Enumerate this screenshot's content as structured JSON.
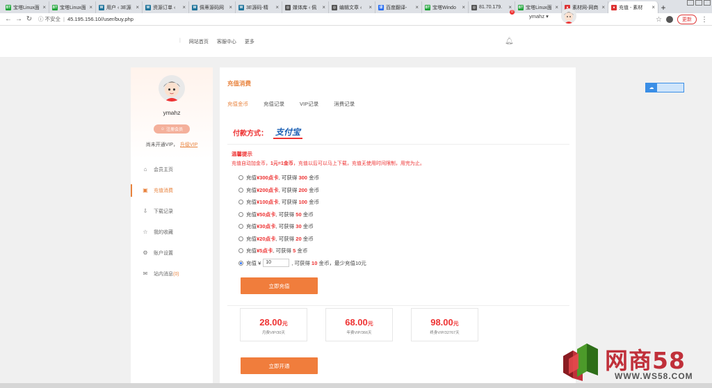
{
  "browser": {
    "tabs": [
      {
        "label": "宝塔Linux面",
        "fav": "BT",
        "color": "#20a53a"
      },
      {
        "label": "宝塔Linux面",
        "fav": "BT",
        "color": "#20a53a"
      },
      {
        "label": "用户 ‹ 3E源",
        "fav": "W",
        "color": "#21759b"
      },
      {
        "label": "资源订单 ‹",
        "fav": "W",
        "color": "#21759b"
      },
      {
        "label": "佩蒂源码网",
        "fav": "W",
        "color": "#21759b"
      },
      {
        "label": "3E源码-精",
        "fav": "W",
        "color": "#21759b"
      },
      {
        "label": "媒体库 ‹ 佩",
        "fav": "◎",
        "color": "#555"
      },
      {
        "label": "编辑文章 ‹",
        "fav": "◎",
        "color": "#555"
      },
      {
        "label": "百度翻译-",
        "fav": "译",
        "color": "#2a6ef0"
      },
      {
        "label": "宝塔Windo",
        "fav": "BT",
        "color": "#20a53a"
      },
      {
        "label": "81.70.179.",
        "fav": "◎",
        "color": "#555"
      },
      {
        "label": "宝塔Linux面",
        "fav": "BT",
        "color": "#20a53a"
      },
      {
        "label": "素材网-网商",
        "fav": "●",
        "color": "#d33"
      },
      {
        "label": "充值 - 素材",
        "fav": "●",
        "color": "#d33",
        "active": true
      }
    ],
    "insecure_label": "不安全",
    "url": "45.195.156.10//user/buy.php",
    "update_label": "更新"
  },
  "header": {
    "nav": [
      "网站首页",
      "客服中心",
      "更多"
    ],
    "notif_count": "0",
    "username": "ymahz ▾"
  },
  "sidebar": {
    "username": "ymahz",
    "badge": "注册会员",
    "vip_status": "尚未开通VIP，",
    "upgrade": "升级VIP",
    "items": [
      {
        "label": "会员主页",
        "icon": "⌂",
        "name": "home-icon"
      },
      {
        "label": "充值消费",
        "icon": "▣",
        "name": "wallet-icon",
        "active": true
      },
      {
        "label": "下载记录",
        "icon": "⇩",
        "name": "download-icon"
      },
      {
        "label": "我的收藏",
        "icon": "☆",
        "name": "star-icon"
      },
      {
        "label": "账户设置",
        "icon": "⚙",
        "name": "gear-icon"
      },
      {
        "label": "站内消息",
        "icon": "✉",
        "name": "mail-icon",
        "count": "(0)"
      }
    ]
  },
  "main": {
    "title": "充值消费",
    "tabs": [
      "充值金币",
      "充值记录",
      "VIP记录",
      "消费记录"
    ],
    "pay_label": "付款方式：",
    "pay_method": "支付宝",
    "notice_title": "温馨提示",
    "notice_pre": "充值自动加金币，",
    "notice_strong": "1元=1金币",
    "notice_post": "，充值以后可以马上下载，充值无使用时间限制，用完为止。",
    "options": [
      {
        "card": "¥300点卡",
        "coins": "300"
      },
      {
        "card": "¥200点卡",
        "coins": "200"
      },
      {
        "card": "¥100点卡",
        "coins": "100"
      },
      {
        "card": "¥50点卡",
        "coins": "50"
      },
      {
        "card": "¥30点卡",
        "coins": "30"
      },
      {
        "card": "¥20点卡",
        "coins": "20"
      },
      {
        "card": "¥5点卡",
        "coins": "5"
      }
    ],
    "opt_prefix": "充值",
    "opt_mid": ", 可获得",
    "opt_suffix": "金币",
    "custom": {
      "prefix": "充值 ¥",
      "value": "10",
      "mid": ", 可获得",
      "coins": "10",
      "suffix": "金币，最少充值10元"
    },
    "recharge_button": "立即充值",
    "vip_cards": [
      {
        "price": "28.00",
        "unit": "元",
        "desc": "月费VIP/30天"
      },
      {
        "price": "68.00",
        "unit": "元",
        "desc": "年费VIP/366天"
      },
      {
        "price": "98.00",
        "unit": "元",
        "desc": "终身VIP/32767天"
      }
    ],
    "open_button": "立即开通"
  },
  "watermark": {
    "text": "网商58",
    "sub": "WWW.WS58.COM"
  }
}
